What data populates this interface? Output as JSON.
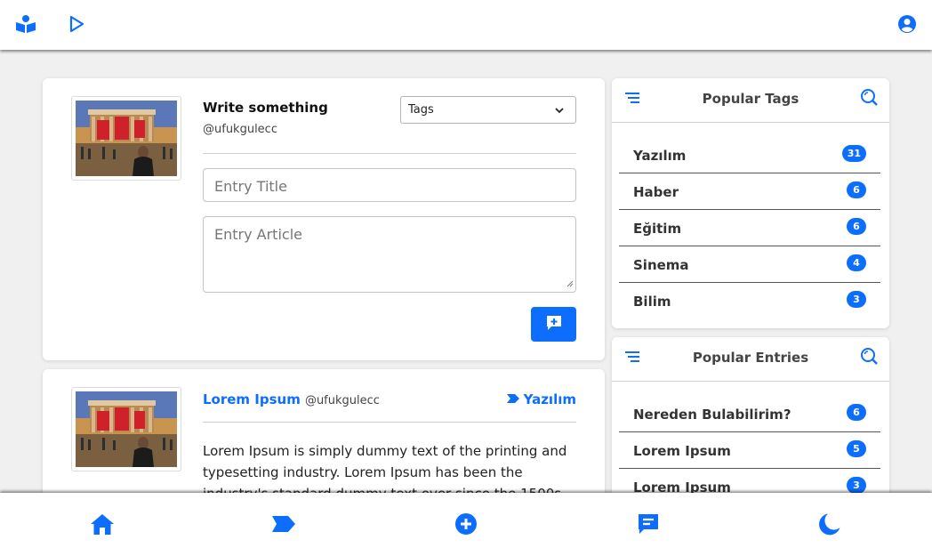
{
  "header": {
    "left_icons": [
      "book-reader-icon",
      "play-icon"
    ],
    "right_icon": "user-circle-icon"
  },
  "compose": {
    "title": "Write something",
    "handle": "@ufukgulecc",
    "tags_select": "Tags",
    "entry_title_placeholder": "Entry Title",
    "entry_article_placeholder": "Entry Article",
    "submit_icon": "comment-plus-icon"
  },
  "post": {
    "author": "Lorem Ipsum",
    "handle": "@ufukgulecc",
    "tag": "Yazılım",
    "body": "Lorem Ipsum is simply dummy text of the printing and typesetting industry. Lorem Ipsum has been the industry's standard dummy text ever since the 1500s"
  },
  "popular_tags": {
    "title": "Popular Tags",
    "items": [
      {
        "label": "Yazılım",
        "count": "31"
      },
      {
        "label": "Haber",
        "count": "6"
      },
      {
        "label": "Eğitim",
        "count": "6"
      },
      {
        "label": "Sinema",
        "count": "4"
      },
      {
        "label": "Bilim",
        "count": "3"
      }
    ]
  },
  "popular_entries": {
    "title": "Popular Entries",
    "items": [
      {
        "label": "Nereden Bulabilirim?",
        "count": "6"
      },
      {
        "label": "Lorem Ipsum",
        "count": "5"
      },
      {
        "label": "Lorem Ipsum",
        "count": "3"
      }
    ]
  },
  "bottom_nav": [
    "home-icon",
    "tag-icon",
    "plus-circle-icon",
    "message-icon",
    "moon-icon"
  ],
  "colors": {
    "accent": "#0d6efd",
    "background": "#f0f0f0"
  }
}
